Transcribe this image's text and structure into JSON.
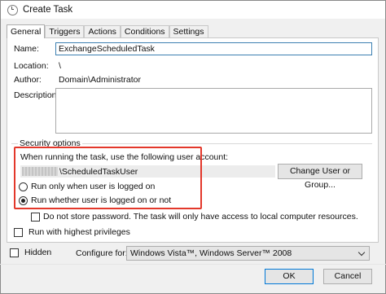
{
  "window": {
    "title": "Create Task",
    "title_icon": "task-scheduler-icon"
  },
  "tabs": [
    {
      "label": "General",
      "active": true
    },
    {
      "label": "Triggers",
      "active": false
    },
    {
      "label": "Actions",
      "active": false
    },
    {
      "label": "Conditions",
      "active": false
    },
    {
      "label": "Settings",
      "active": false
    }
  ],
  "general": {
    "name_label": "Name:",
    "name_value": "ExchangeScheduledTask",
    "location_label": "Location:",
    "location_value": "\\",
    "author_label": "Author:",
    "author_value": "Domain\\Administrator",
    "description_label": "Description:",
    "description_value": ""
  },
  "security": {
    "group_label": "Security options",
    "account_prompt": "When running the task, use the following user account:",
    "user_account": "\\ScheduledTaskUser",
    "change_button": "Change User or Group...",
    "radio_logged_on": "Run only when user is logged on",
    "radio_logged_on_checked": false,
    "radio_whether": "Run whether user is logged on or not",
    "radio_whether_checked": true,
    "store_password_label": "Do not store password.  The task will only have access to local computer resources.",
    "store_password_checked": false,
    "highest_privileges_label": "Run with highest privileges",
    "highest_privileges_checked": false
  },
  "footer": {
    "hidden_label": "Hidden",
    "hidden_checked": false,
    "configure_label": "Configure for:",
    "configure_value": "Windows Vista™, Windows Server™ 2008",
    "ok_button": "OK",
    "cancel_button": "Cancel"
  },
  "colors": {
    "highlight": "#e3382b",
    "focus_border": "#3c7fb1",
    "ok_border": "#0078d7"
  }
}
